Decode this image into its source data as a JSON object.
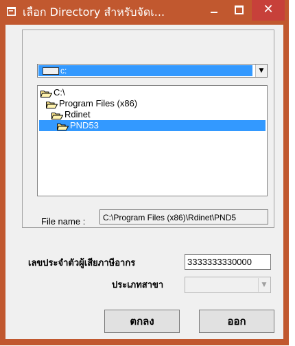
{
  "window": {
    "title": "เลือก Directory สำหรับจัดเ...",
    "close_label": "✕",
    "colors": {
      "titlebar": "#c1582f",
      "close": "#c7403a",
      "selection": "#3399ff"
    }
  },
  "drive": {
    "value": "c:",
    "icon": "drive-icon",
    "arrow": "▼"
  },
  "directories": [
    {
      "label": "C:\\",
      "icon": "open-folder-icon",
      "selected": false
    },
    {
      "label": "Program Files (x86)",
      "icon": "open-folder-icon",
      "selected": false
    },
    {
      "label": "Rdinet",
      "icon": "open-folder-icon",
      "selected": false
    },
    {
      "label": "PND53",
      "icon": "open-folder-icon",
      "selected": true
    }
  ],
  "file_name": {
    "label": "File name :",
    "value": "C:\\Program Files (x86)\\Rdinet\\PND5"
  },
  "tax_id": {
    "label": "เลขประจำตัวผู้เสียภาษีอากร",
    "value": "3333333330000"
  },
  "branch_type": {
    "label": "ประเภทสาขา",
    "value": "",
    "arrow": "▼"
  },
  "buttons": {
    "ok": "ตกลง",
    "exit": "ออก"
  }
}
